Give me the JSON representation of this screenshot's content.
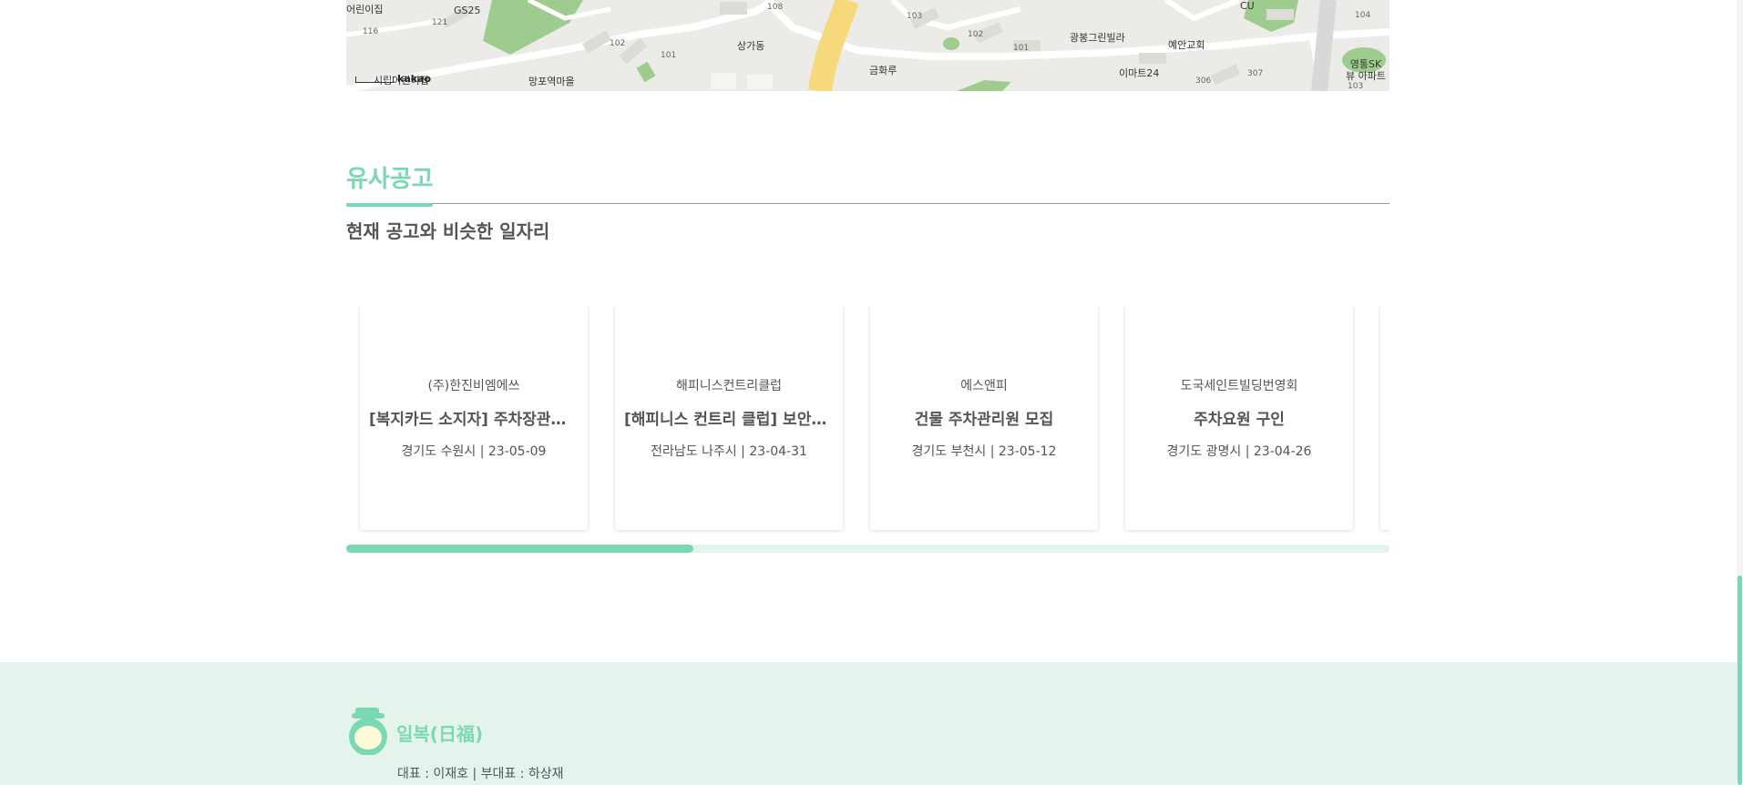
{
  "map": {
    "places": [
      "어린이집",
      "GS25",
      "상가동",
      "광봉그린빌라",
      "예안교회",
      "CU",
      "금화루",
      "이마트24",
      "영통SK뷰 아파트",
      "망포역마을",
      "시립어린이집"
    ],
    "building_numbers": [
      "116",
      "121",
      "102",
      "101",
      "108",
      "103",
      "102",
      "101",
      "306",
      "307",
      "104",
      "103"
    ],
    "attribution": "kakao"
  },
  "section": {
    "title": "유사공고",
    "subtitle": "현재 공고와 비슷한 일자리"
  },
  "cards": [
    {
      "company": "(주)한진비엠에쓰",
      "title": "[복지카드 소지자] 주차장관리원 모집",
      "meta": "경기도 수원시 | 23-05-09"
    },
    {
      "company": "해피니스컨트리클럽",
      "title": "[해피니스 컨트리 클럽] 보안요원 모집",
      "meta": "전라남도 나주시 | 23-04-31"
    },
    {
      "company": "에스앤피",
      "title": "건물 주차관리원 모집",
      "meta": "경기도 부천시 | 23-05-12"
    },
    {
      "company": "도국세인트빌딩번영회",
      "title": "주차요원 구인",
      "meta": "경기도 광명시 | 23-04-26"
    }
  ],
  "scroll_progress": 0.333,
  "footer": {
    "brand": "일복(日福)",
    "representatives": "대표 : 이재호 | 부대표 : 하상재"
  },
  "colors": {
    "accent": "#7ad9b2",
    "footer_bg": "#e4f3ec"
  }
}
